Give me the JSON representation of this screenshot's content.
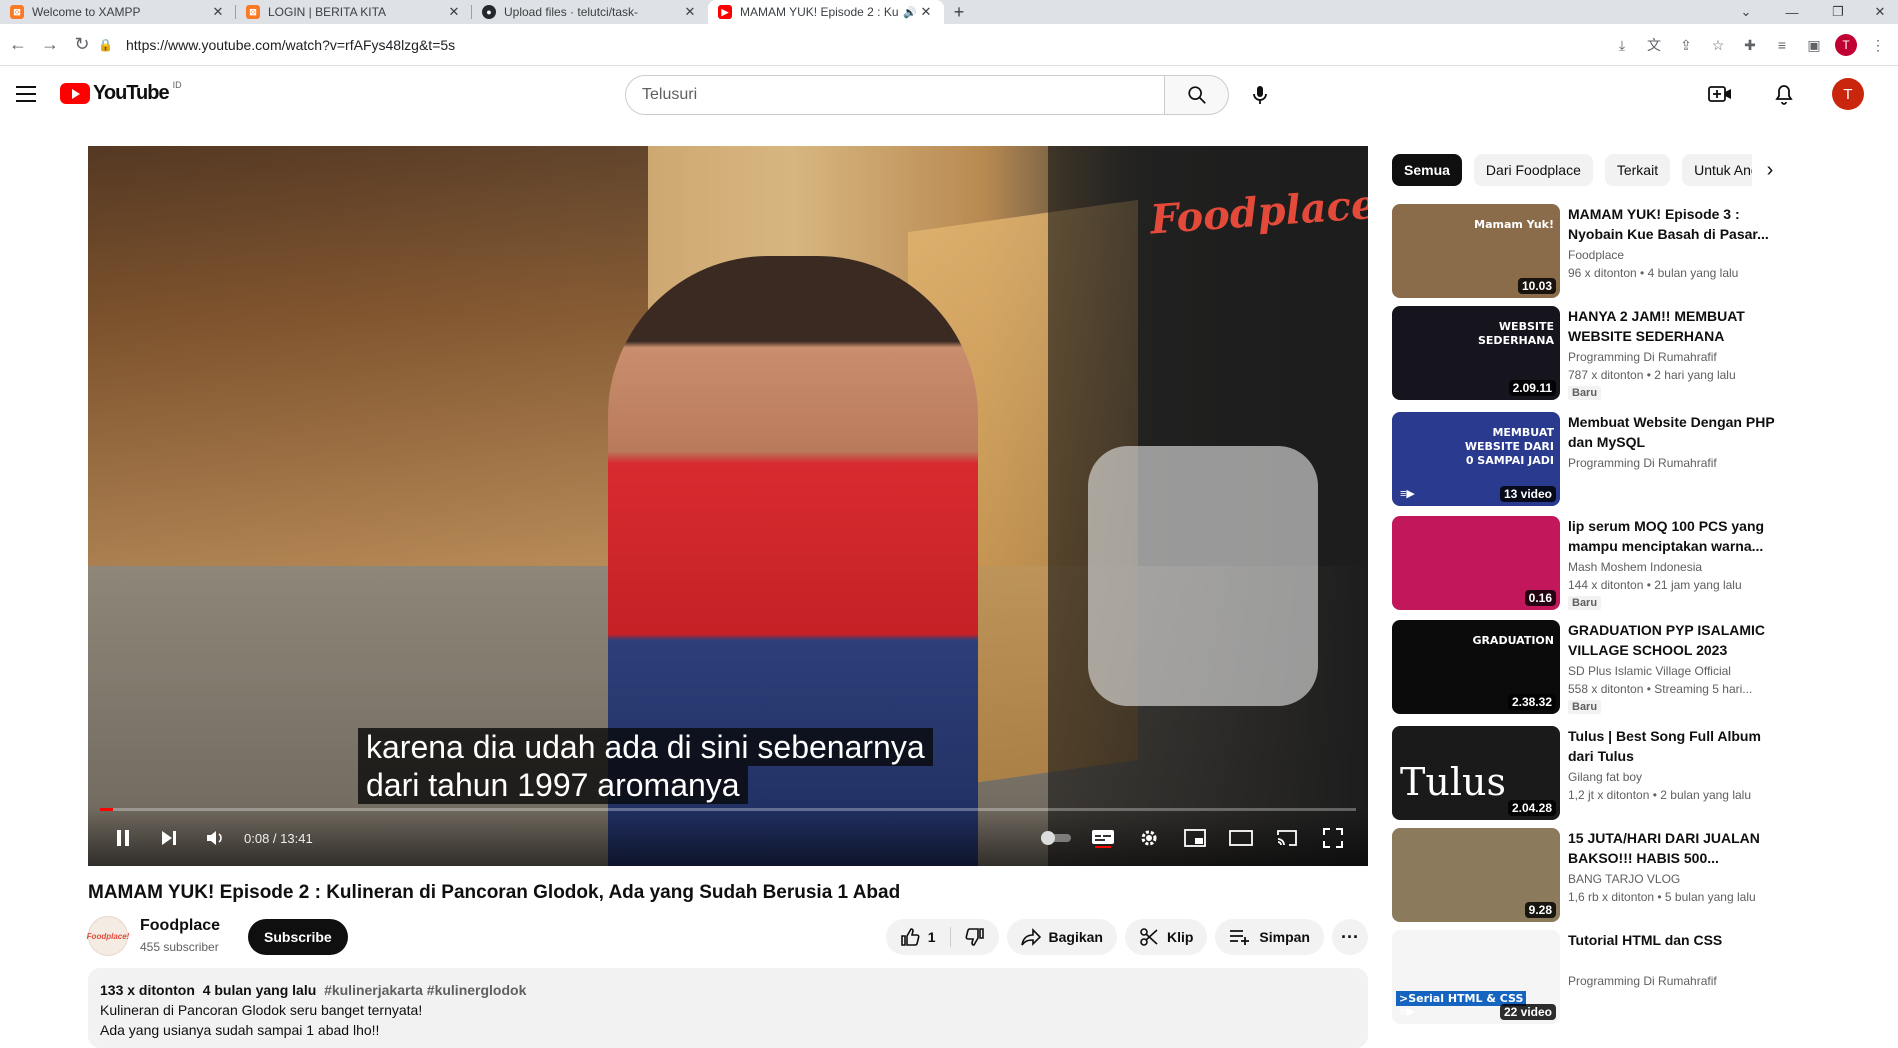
{
  "browser": {
    "tabs": [
      {
        "title": "Welcome to XAMPP",
        "favicon_color": "#fb7a24"
      },
      {
        "title": "LOGIN | BERITA KITA",
        "favicon_color": "#fb7a24"
      },
      {
        "title": "Upload files · telutci/task-",
        "favicon_color": "#24292f"
      },
      {
        "title": "MAMAM YUK! Episode 2 : Ku",
        "favicon_color": "#ff0000"
      }
    ],
    "url": "https://www.youtube.com/watch?v=rfAFys48lzg&t=5s",
    "profile_initial": "T"
  },
  "header": {
    "logo_text": "YouTube",
    "country_code": "ID",
    "search_placeholder": "Telusuri",
    "avatar_initial": "T"
  },
  "player": {
    "watermark": "Foodplace!",
    "caption_lines": [
      "karena dia udah ada di sini sebenarnya",
      "dari tahun 1997 aromanya"
    ],
    "current_time": "0:08 / 13:41",
    "progress": 0.01
  },
  "video": {
    "title": "MAMAM YUK! Episode 2 : Kulineran di Pancoran Glodok, Ada yang Sudah Berusia 1 Abad",
    "channel": "Foodplace",
    "subscribers": "455 subscriber",
    "subscribe_label": "Subscribe",
    "likes": "1",
    "share_label": "Bagikan",
    "clip_label": "Klip",
    "save_label": "Simpan",
    "more_label": "···",
    "views": "133 x ditonton",
    "age": "4 bulan yang lalu",
    "hashtags": "#kulinerjakarta #kulinerglodok",
    "desc_line1": "Kulineran di Pancoran Glodok seru banget ternyata!",
    "desc_line2": "Ada yang usianya sudah sampai 1 abad lho!!"
  },
  "chips": [
    "Semua",
    "Dari Foodplace",
    "Terkait",
    "Untuk Anda"
  ],
  "recommendations": [
    {
      "title": "MAMAM YUK! Episode 3 : Nyobain Kue Basah di Pasar...",
      "channel": "Foodplace",
      "meta": "96 x ditonton • 4 bulan yang lalu",
      "duration": "10.03",
      "badge": "",
      "thumb_color": "#8a6b4a",
      "thumb_text": "Mamam Yuk!"
    },
    {
      "title": "HANYA 2 JAM!! MEMBUAT WEBSITE SEDERHANA DENGA...",
      "channel": "Programming Di Rumahrafif",
      "meta": "787 x ditonton • 2 hari yang lalu",
      "duration": "2.09.11",
      "badge": "Baru",
      "thumb_color": "#16151d",
      "thumb_text": "WEBSITE SEDERHANA"
    },
    {
      "title": "Membuat Website Dengan PHP dan MySQL",
      "channel": "Programming Di Rumahrafif",
      "meta": "",
      "duration": "13 video",
      "badge": "",
      "thumb_color": "#2a3a8f",
      "thumb_text": "MEMBUAT WEBSITE DARI 0 SAMPAI JADI"
    },
    {
      "title": "lip serum MOQ 100 PCS yang mampu menciptakan warna...",
      "channel": "Mash Moshem Indonesia",
      "meta": "144 x ditonton • 21 jam yang lalu",
      "duration": "0.16",
      "badge": "Baru",
      "thumb_color": "#c2185b",
      "thumb_text": ""
    },
    {
      "title": "GRADUATION PYP ISALAMIC VILLAGE SCHOOL 2023",
      "channel": "SD Plus Islamic Village Official",
      "meta": "558 x ditonton • Streaming 5 hari...",
      "duration": "2.38.32",
      "badge": "Baru",
      "thumb_color": "#0b0b0b",
      "thumb_text": "GRADUATION"
    },
    {
      "title": "Tulus | Best Song Full Album dari Tulus",
      "channel": "Gilang fat boy",
      "meta": "1,2 jt x ditonton • 2 bulan yang lalu",
      "duration": "2.04.28",
      "badge": "",
      "thumb_color": "#1a1a1a",
      "thumb_text": "Tulus"
    },
    {
      "title": "15 JUTA/HARI DARI JUALAN BAKSO!!! HABIS 500...",
      "channel": "BANG TARJO VLOG",
      "meta": "1,6 rb x ditonton • 5 bulan yang lalu",
      "duration": "9.28",
      "badge": "",
      "thumb_color": "#8c7a5c",
      "thumb_text": ""
    },
    {
      "title": "Tutorial HTML dan CSS",
      "channel": "Programming Di Rumahrafif",
      "meta": "",
      "duration": "22 video",
      "badge": "",
      "thumb_color": "#f5f5f5",
      "thumb_text": ">Serial HTML & CSS"
    }
  ]
}
